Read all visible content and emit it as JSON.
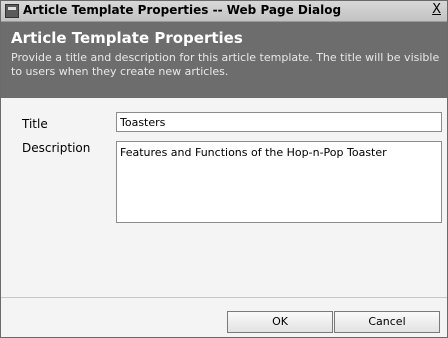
{
  "window": {
    "title": "Article Template Properties -- Web Page Dialog",
    "close_label": "X"
  },
  "header": {
    "title": "Article Template Properties",
    "description": "Provide a title and description for this article template. The title will be visible to users when they create new articles."
  },
  "form": {
    "title_label": "Title",
    "title_value": "Toasters",
    "description_label": "Description",
    "description_value": "Features and Functions of the Hop-n-Pop Toaster"
  },
  "buttons": {
    "ok_label": "OK",
    "cancel_label": "Cancel"
  }
}
